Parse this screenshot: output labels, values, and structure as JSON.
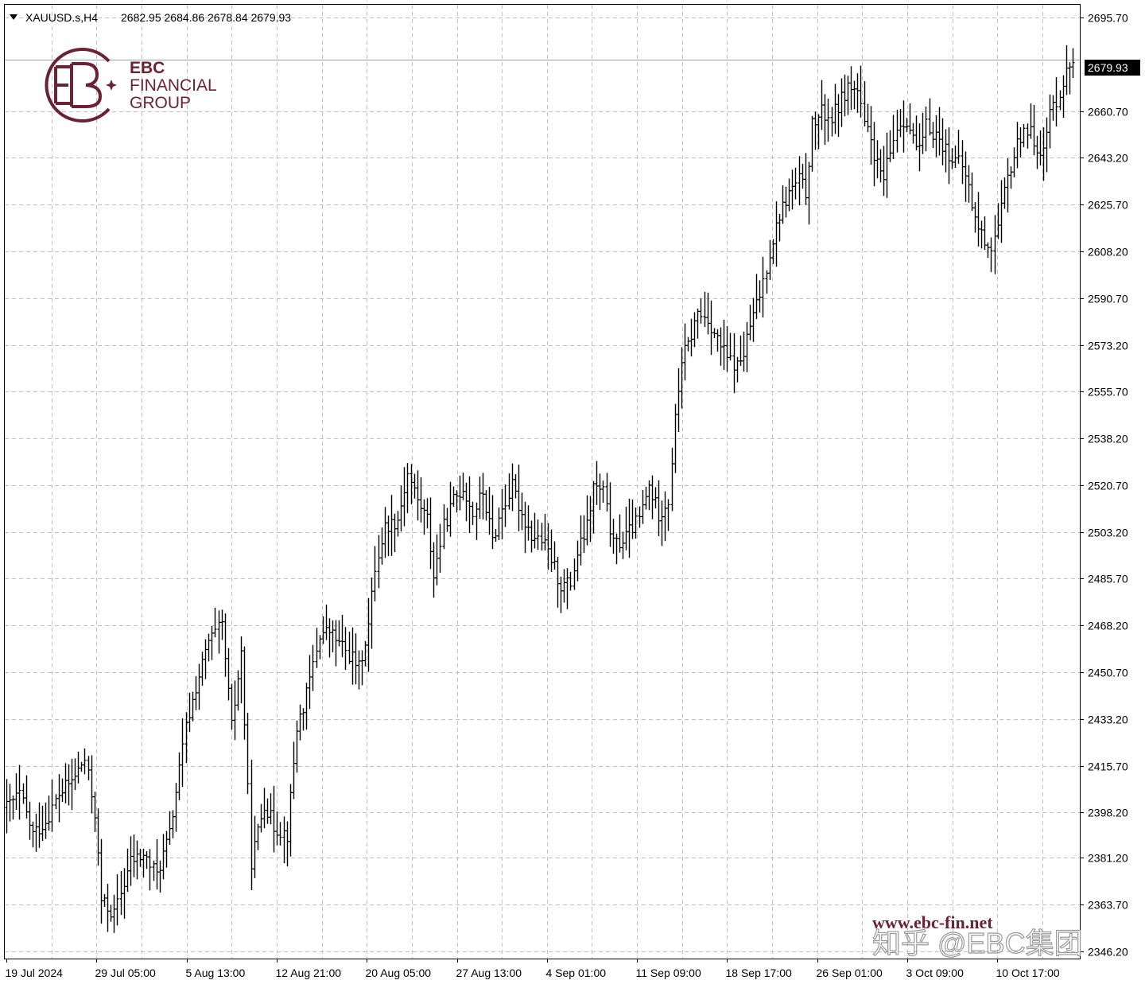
{
  "header": {
    "symbol": "XAUUSD.s,H4",
    "ohlc": "2682.95 2684.86 2678.84 2679.93",
    "dropdown_icon": "triangle-down-icon"
  },
  "brand": {
    "logo_icon": "ebc-logo",
    "line1": "EBC",
    "line2": "FINANCIAL",
    "line3": "GROUP",
    "color": "#6b2233"
  },
  "watermark": {
    "url": "www.ebc-fin.net",
    "zhihu": "知乎 @EBC集团"
  },
  "price_label": "2679.93",
  "colors": {
    "bars": "#000000",
    "grid": "#c0c0c0",
    "price_line": "#a0a0a0",
    "brand": "#6b2233"
  },
  "chart_data": {
    "type": "ohlc-bar",
    "symbol": "XAUUSD.s",
    "timeframe": "H4",
    "y_ticks": [
      "2695.70",
      "2660.70",
      "2643.20",
      "2625.70",
      "2608.20",
      "2590.70",
      "2573.20",
      "2555.70",
      "2538.20",
      "2520.70",
      "2503.20",
      "2485.70",
      "2468.20",
      "2450.70",
      "2433.20",
      "2415.70",
      "2398.20",
      "2381.20",
      "2363.70",
      "2346.20"
    ],
    "x_ticks": [
      "19 Jul 2024",
      "29 Jul 05:00",
      "5 Aug 13:00",
      "12 Aug 21:00",
      "20 Aug 05:00",
      "27 Aug 13:00",
      "4 Sep 01:00",
      "11 Sep 09:00",
      "18 Sep 17:00",
      "26 Sep 01:00",
      "3 Oct 09:00",
      "10 Oct 17:00"
    ],
    "ylim": [
      2343.5,
      2700.5
    ],
    "grid": true,
    "current_price": 2679.93,
    "key_path": [
      [
        0,
        2400
      ],
      [
        4,
        2405
      ],
      [
        8,
        2390
      ],
      [
        12,
        2395
      ],
      [
        16,
        2405
      ],
      [
        20,
        2410
      ],
      [
        24,
        2418
      ],
      [
        27,
        2398
      ],
      [
        29,
        2365
      ],
      [
        33,
        2360
      ],
      [
        38,
        2380
      ],
      [
        42,
        2382
      ],
      [
        46,
        2375
      ],
      [
        50,
        2390
      ],
      [
        55,
        2430
      ],
      [
        58,
        2445
      ],
      [
        62,
        2462
      ],
      [
        66,
        2468
      ],
      [
        69,
        2430
      ],
      [
        72,
        2458
      ],
      [
        75,
        2380
      ],
      [
        79,
        2402
      ],
      [
        82,
        2393
      ],
      [
        86,
        2390
      ],
      [
        89,
        2430
      ],
      [
        92,
        2442
      ],
      [
        96,
        2465
      ],
      [
        99,
        2466
      ],
      [
        103,
        2460
      ],
      [
        106,
        2456
      ],
      [
        108,
        2452
      ],
      [
        111,
        2468
      ],
      [
        113,
        2490
      ],
      [
        116,
        2505
      ],
      [
        120,
        2508
      ],
      [
        123,
        2525
      ],
      [
        126,
        2515
      ],
      [
        129,
        2508
      ],
      [
        131,
        2487
      ],
      [
        134,
        2505
      ],
      [
        137,
        2515
      ],
      [
        140,
        2520
      ],
      [
        143,
        2510
      ],
      [
        146,
        2518
      ],
      [
        149,
        2500
      ],
      [
        152,
        2512
      ],
      [
        155,
        2520
      ],
      [
        158,
        2510
      ],
      [
        161,
        2502
      ],
      [
        164,
        2500
      ],
      [
        167,
        2493
      ],
      [
        170,
        2483
      ],
      [
        173,
        2484
      ],
      [
        175,
        2495
      ],
      [
        178,
        2505
      ],
      [
        180,
        2520
      ],
      [
        183,
        2518
      ],
      [
        186,
        2498
      ],
      [
        189,
        2500
      ],
      [
        192,
        2505
      ],
      [
        194,
        2508
      ],
      [
        197,
        2520
      ],
      [
        200,
        2510
      ],
      [
        203,
        2515
      ],
      [
        205,
        2545
      ],
      [
        207,
        2568
      ],
      [
        209,
        2573
      ],
      [
        212,
        2585
      ],
      [
        215,
        2583
      ],
      [
        218,
        2575
      ],
      [
        221,
        2568
      ],
      [
        224,
        2565
      ],
      [
        226,
        2570
      ],
      [
        228,
        2580
      ],
      [
        231,
        2592
      ],
      [
        234,
        2608
      ],
      [
        237,
        2622
      ],
      [
        240,
        2630
      ],
      [
        243,
        2635
      ],
      [
        245,
        2630
      ],
      [
        247,
        2655
      ],
      [
        250,
        2660
      ],
      [
        253,
        2658
      ],
      [
        256,
        2665
      ],
      [
        258,
        2670
      ],
      [
        261,
        2668
      ],
      [
        263,
        2655
      ],
      [
        265,
        2650
      ],
      [
        267,
        2640
      ],
      [
        269,
        2635
      ],
      [
        271,
        2645
      ],
      [
        273,
        2655
      ],
      [
        276,
        2658
      ],
      [
        278,
        2650
      ],
      [
        280,
        2645
      ],
      [
        282,
        2655
      ],
      [
        285,
        2652
      ],
      [
        287,
        2648
      ],
      [
        289,
        2645
      ],
      [
        291,
        2642
      ],
      [
        293,
        2640
      ],
      [
        295,
        2632
      ],
      [
        297,
        2620
      ],
      [
        300,
        2612
      ],
      [
        302,
        2610
      ],
      [
        304,
        2617
      ],
      [
        306,
        2630
      ],
      [
        308,
        2640
      ],
      [
        310,
        2648
      ],
      [
        312,
        2655
      ],
      [
        314,
        2652
      ],
      [
        316,
        2648
      ],
      [
        318,
        2645
      ],
      [
        320,
        2660
      ],
      [
        322,
        2665
      ],
      [
        324,
        2672
      ],
      [
        326,
        2678
      ],
      [
        327,
        2680
      ]
    ]
  }
}
